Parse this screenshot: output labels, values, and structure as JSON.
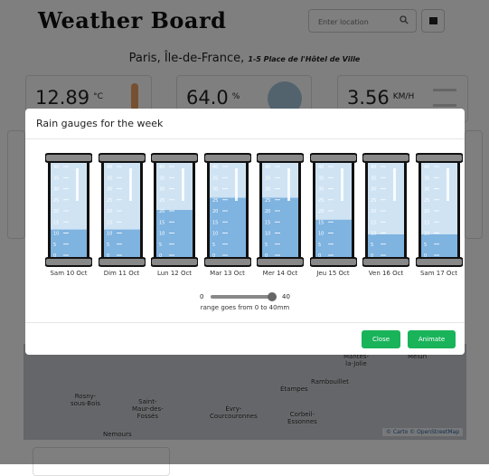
{
  "header": {
    "brand": "Weather Board",
    "search_placeholder": "Enter location",
    "location_city": "Paris, Île-de-France,",
    "location_address": "1-5 Place de l'Hôtel de Ville"
  },
  "cards": [
    {
      "value": "12.89",
      "unit": "°C"
    },
    {
      "value": "64.0",
      "unit": "%"
    },
    {
      "value": "3.56",
      "unit": "KM/H"
    }
  ],
  "map": {
    "places": [
      "Rosny-\nsous-Bois",
      "Saint-\nMaur-des-\nFossés",
      "Évry-\nCourcouronnes",
      "Étampes",
      "Rambouillet",
      "Mantes-\nla-Jolie",
      "Melun",
      "Corbeil-\nEssonnes",
      "Nemours"
    ],
    "attribution": "© Carto © OpenStreetMap"
  },
  "modal": {
    "title": "Rain gauges for the week",
    "gauges": [
      {
        "day": "Sam 10 Oct",
        "level": 12
      },
      {
        "day": "Dim 11 Oct",
        "level": 12
      },
      {
        "day": "Lun 12 Oct",
        "level": 20
      },
      {
        "day": "Mar 13 Oct",
        "level": 25
      },
      {
        "day": "Mer 14 Oct",
        "level": 25
      },
      {
        "day": "Jeu 15 Oct",
        "level": 16
      },
      {
        "day": "Ven 16 Oct",
        "level": 10
      },
      {
        "day": "Sam 17 Oct",
        "level": 10
      }
    ],
    "scale_max": 40,
    "tick_values": [
      "40",
      "35",
      "30",
      "25",
      "20",
      "15",
      "10",
      "5",
      "0"
    ],
    "slider": {
      "min_label": "0",
      "max_label": "40",
      "value": 40
    },
    "range_note": "range goes from 0 to 40mm",
    "close_label": "Close",
    "animate_label": "Animate"
  },
  "colors": {
    "button_green": "#19b35a",
    "gauge_water": "#7fb3e0",
    "gauge_empty": "#cfe3f3",
    "gauge_cap": "#888888"
  }
}
